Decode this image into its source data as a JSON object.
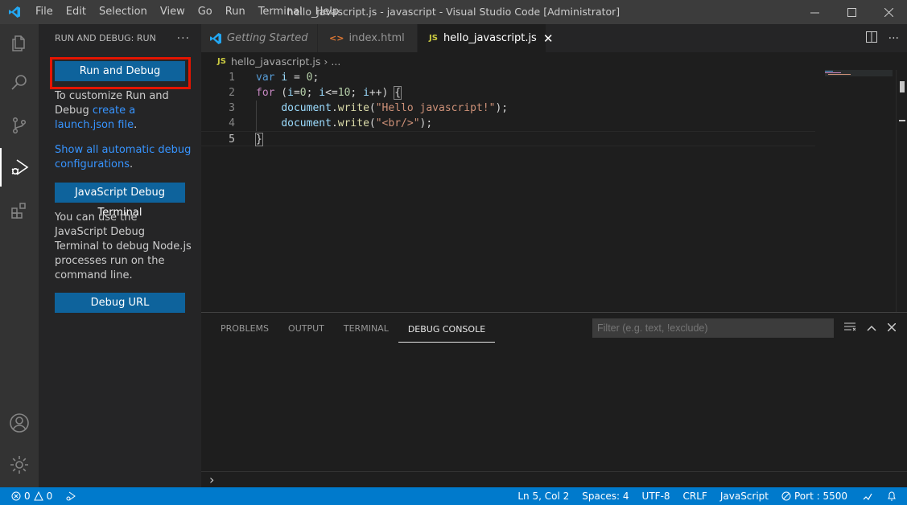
{
  "titlebar": {
    "menu": [
      "File",
      "Edit",
      "Selection",
      "View",
      "Go",
      "Run",
      "Terminal",
      "Help"
    ],
    "title": "hello_javascript.js - javascript - Visual Studio Code [Administrator]"
  },
  "activity": [
    "files-icon",
    "search-icon",
    "source-control-icon",
    "run-debug-icon",
    "extensions-icon",
    "account-icon",
    "settings-gear-icon"
  ],
  "sidebar": {
    "header": "RUN AND DEBUG: RUN",
    "more": "···",
    "run_button": "Run and Debug",
    "customize_pre": "To customize Run and Debug ",
    "customize_link": "create a launch.json file",
    "customize_post": ".",
    "show_link": "Show all automatic debug configurations",
    "show_post": ".",
    "js_terminal_button": "JavaScript Debug Terminal",
    "js_terminal_text": "You can use the JavaScript Debug Terminal to debug Node.js processes run on the command line.",
    "debug_url_button": "Debug URL"
  },
  "tabs": [
    {
      "label": "Getting Started",
      "icon": "vscode-icon"
    },
    {
      "label": "index.html",
      "icon": "<>"
    },
    {
      "label": "hello_javascript.js",
      "icon": "JS",
      "active": true
    }
  ],
  "breadcrumb": {
    "icon": "JS",
    "file": "hello_javascript.js",
    "sep": "›",
    "rest": "..."
  },
  "editor": {
    "line_numbers": [
      "1",
      "2",
      "3",
      "4",
      "5"
    ],
    "lines": [
      "var i = 0;",
      "for (i=0; i<=10; i++) {",
      "    document.write(\"Hello javascript!\");",
      "    document.write(\"<br/>\");",
      "}"
    ]
  },
  "panel": {
    "tabs": [
      "PROBLEMS",
      "OUTPUT",
      "TERMINAL",
      "DEBUG CONSOLE"
    ],
    "active_tab": "DEBUG CONSOLE",
    "filter_placeholder": "Filter (e.g. text, !exclude)",
    "prompt": "›"
  },
  "status": {
    "errors": "0",
    "warnings": "0",
    "position": "Ln 5, Col 2",
    "spaces": "Spaces: 4",
    "encoding": "UTF-8",
    "eol": "CRLF",
    "language": "JavaScript",
    "port": "Port : 5500"
  },
  "colors": {
    "accent": "#007acc",
    "button": "#0e639c",
    "highlight": "#e51400"
  }
}
